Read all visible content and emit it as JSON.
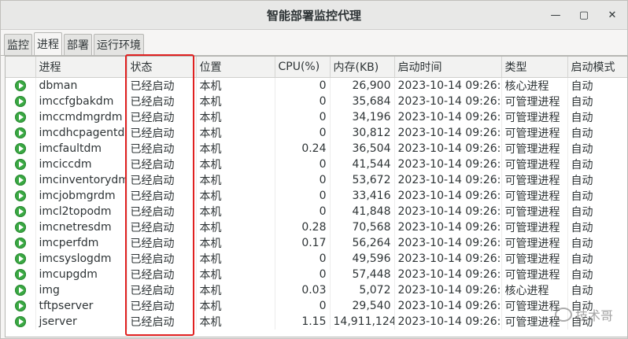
{
  "window": {
    "title": "智能部署监控代理",
    "controls": {
      "minimize": "—",
      "maximize": "▢",
      "close": "✕"
    }
  },
  "tabs": [
    {
      "label": "监控"
    },
    {
      "label": "进程",
      "active": true
    },
    {
      "label": "部署"
    },
    {
      "label": "运行环境"
    }
  ],
  "table": {
    "headers": [
      "进程",
      "状态",
      "位置",
      "CPU(%)",
      "内存(KB)",
      "启动时间",
      "类型",
      "启动模式"
    ],
    "rows": [
      [
        "dbman",
        "已经启动",
        "本机",
        "0",
        "26,900",
        "2023-10-14 09:26:...",
        "核心进程",
        "自动"
      ],
      [
        "imccfgbakdm",
        "已经启动",
        "本机",
        "0",
        "35,684",
        "2023-10-14 09:26:...",
        "可管理进程",
        "自动"
      ],
      [
        "imccmdmgrdm",
        "已经启动",
        "本机",
        "0",
        "34,196",
        "2023-10-14 09:26:...",
        "可管理进程",
        "自动"
      ],
      [
        "imcdhcpagentdm",
        "已经启动",
        "本机",
        "0",
        "30,812",
        "2023-10-14 09:26:...",
        "可管理进程",
        "自动"
      ],
      [
        "imcfaultdm",
        "已经启动",
        "本机",
        "0.24",
        "36,504",
        "2023-10-14 09:26:...",
        "可管理进程",
        "自动"
      ],
      [
        "imciccdm",
        "已经启动",
        "本机",
        "0",
        "41,544",
        "2023-10-14 09:26:...",
        "可管理进程",
        "自动"
      ],
      [
        "imcinventorydm",
        "已经启动",
        "本机",
        "0",
        "53,672",
        "2023-10-14 09:26:...",
        "可管理进程",
        "自动"
      ],
      [
        "imcjobmgrdm",
        "已经启动",
        "本机",
        "0",
        "33,416",
        "2023-10-14 09:26:...",
        "可管理进程",
        "自动"
      ],
      [
        "imcl2topodm",
        "已经启动",
        "本机",
        "0",
        "41,848",
        "2023-10-14 09:26:...",
        "可管理进程",
        "自动"
      ],
      [
        "imcnetresdm",
        "已经启动",
        "本机",
        "0.28",
        "70,568",
        "2023-10-14 09:26:...",
        "可管理进程",
        "自动"
      ],
      [
        "imcperfdm",
        "已经启动",
        "本机",
        "0.17",
        "56,264",
        "2023-10-14 09:26:...",
        "可管理进程",
        "自动"
      ],
      [
        "imcsyslogdm",
        "已经启动",
        "本机",
        "0",
        "49,596",
        "2023-10-14 09:26:...",
        "可管理进程",
        "自动"
      ],
      [
        "imcupgdm",
        "已经启动",
        "本机",
        "0",
        "57,448",
        "2023-10-14 09:26:...",
        "可管理进程",
        "自动"
      ],
      [
        "img",
        "已经启动",
        "本机",
        "0.03",
        "5,072",
        "2023-10-14 09:26:...",
        "核心进程",
        "自动"
      ],
      [
        "tftpserver",
        "已经启动",
        "本机",
        "0",
        "29,540",
        "2023-10-14 09:26:...",
        "可管理进程",
        "自动"
      ],
      [
        "jserver",
        "已经启动",
        "本机",
        "1.15",
        "14,911,124",
        "2023-10-14 09:26:...",
        "可管理进程",
        "自动"
      ]
    ]
  },
  "watermark": {
    "text": "技术哥"
  },
  "colors": {
    "highlight": "#e02020",
    "running_icon": "#3aa843"
  }
}
